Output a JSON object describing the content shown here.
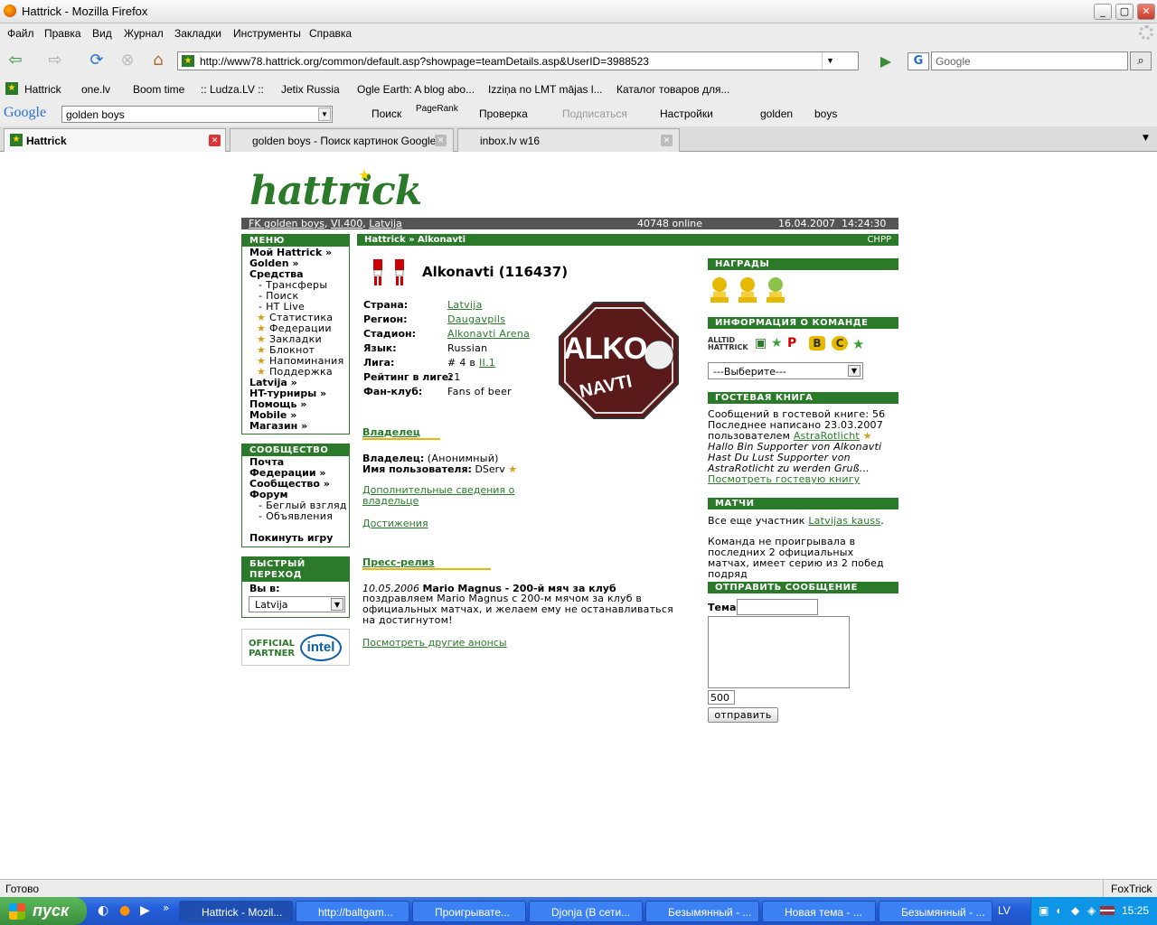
{
  "window": {
    "title": "Hattrick - Mozilla Firefox"
  },
  "menubar": [
    "Файл",
    "Правка",
    "Вид",
    "Журнал",
    "Закладки",
    "Инструменты",
    "Справка"
  ],
  "nav": {
    "url": "http://www78.hattrick.org/common/default.asp?showpage=teamDetails.asp&UserID=3988523",
    "search_placeholder": "Google"
  },
  "bookmarks": [
    "Hattrick",
    "one.lv",
    "Boom time",
    ":: Ludza.LV ::",
    "Jetix Russia",
    "Ogle Earth: A blog abo...",
    "Izziņa no LMT mājas l...",
    "Каталог товаров для..."
  ],
  "google_bar": {
    "logo": "Google",
    "query": "golden boys",
    "search": "Поиск",
    "pagerank": "PageRank",
    "check": "Проверка",
    "subscribe": "Подписаться",
    "settings": "Настройки",
    "word1": "golden",
    "word2": "boys"
  },
  "tabs": [
    "Hattrick",
    "golden boys - Поиск картинок Google",
    "inbox.lv w16"
  ],
  "page": {
    "logo": "hattrick",
    "info": {
      "team_link": "FK golden boys",
      "league_link": "VI.400",
      "country_link": "Latvija",
      "online": "40748 online",
      "datetime": "16.04.2007  14:24:30"
    },
    "menu": {
      "header": "МЕНЮ",
      "items": [
        "Мой Hattrick »",
        "Golden »",
        "Средства"
      ],
      "sub": [
        "Трансферы",
        "Поиск",
        "HT Live",
        "Статистика",
        "Федерации",
        "Закладки",
        "Блокнот",
        "Напоминания",
        "Поддержка"
      ],
      "items2": [
        "Latvija »",
        "HT-турниры »",
        "Помощь »",
        "Mobile »",
        "Магазин »"
      ]
    },
    "community": {
      "header": "СООБЩЕСТВО",
      "items": [
        "Почта",
        "Федерации »",
        "Сообщество »",
        "Форум"
      ],
      "sub": [
        "Беглый взгляд",
        "Объявления"
      ],
      "leave": "Покинуть игру"
    },
    "quick": {
      "header": "БЫСТРЫЙ ПЕРЕХОД",
      "label": "Вы в:",
      "value": "Latvija"
    },
    "partner": {
      "text1": "OFFICIAL",
      "text2": "PARTNER",
      "brand": "intel"
    },
    "breadcrumb": {
      "path": "Hattrick » Alkonavti",
      "chpp": "CHPP"
    },
    "team": {
      "name": "Alkonavti (116437)",
      "logo_top": "ALKO",
      "logo_bottom": "NAVTI",
      "fields": [
        {
          "label": "Страна:",
          "value": "Latvija",
          "link": true
        },
        {
          "label": "Регион:",
          "value": "Daugavpils",
          "link": true
        },
        {
          "label": "Стадион:",
          "value": "Alkonavti Arena",
          "link": true
        },
        {
          "label": "Язык:",
          "value": "Russian",
          "link": false
        },
        {
          "label": "Лига:",
          "value": "# 4 в ",
          "link": false
        },
        {
          "label": "Рейтинг в лиге:",
          "value": "21",
          "link": false
        },
        {
          "label": "Фан-клуб:",
          "value": "Fans of beer",
          "link": false
        }
      ],
      "league_link": "II.1"
    },
    "owner": {
      "header": "Владелец",
      "owner_label": "Владелец:",
      "owner_value": "(Анонимный)",
      "user_label": "Имя пользователя:",
      "user_value": "DServ",
      "more_link": "Дополнительные сведения о владельце",
      "achievements": "Достижения"
    },
    "press": {
      "header": "Пресс-релиз",
      "date": "10.05.2006",
      "title": "Mario Magnus - 200-й мяч за клуб",
      "body": "поздравляем Mario Magnus с 200-м мячом за клуб в официальных матчах, и желаем ему не останавливаться на достигнутом!",
      "more": "Посмотреть другие анонсы"
    },
    "awards": {
      "header": "НАГРАДЫ"
    },
    "teaminfo": {
      "header": "ИНФОРМАЦИЯ О КОМАНДЕ",
      "alltid": "ALLTID HATTRICK",
      "select": "---Выберите---"
    },
    "guestbook": {
      "header": "ГОСТЕВАЯ КНИГА",
      "count": "Сообщений в гостевой книге: 56",
      "last": "Последнее написано 23.03.2007",
      "by": "пользователем ",
      "user": "AstraRotlicht",
      "quote": "Hallo Bin Supporter von Alkonavti Hast Du Lust Supporter von AstraRotlicht zu werden Gruß...",
      "link": "Посмотреть гостевую книгу"
    },
    "matches": {
      "header": "МАТЧИ",
      "still": "Все еще участник ",
      "cup": "Latvijas kauss",
      "streak": "Команда не проигрывала в последних 2 официальных матчах, имеет серию из 2 побед подряд"
    },
    "message": {
      "header": "ОТПРАВИТЬ СООБЩЕНИЕ",
      "subject": "Тема",
      "counter": "500",
      "send": "отправить"
    }
  },
  "status": {
    "text": "Готово",
    "addon": "FoxTrick"
  },
  "taskbar": {
    "start": "пуск",
    "tasks": [
      "Hattrick - Mozil...",
      "http://baltgam...",
      "Проигрывате...",
      "Djonja (В сети...",
      "Безымянный - ...",
      "Новая тема - ...",
      "Безымянный - ..."
    ],
    "lang": "LV",
    "clock": "15:25"
  }
}
